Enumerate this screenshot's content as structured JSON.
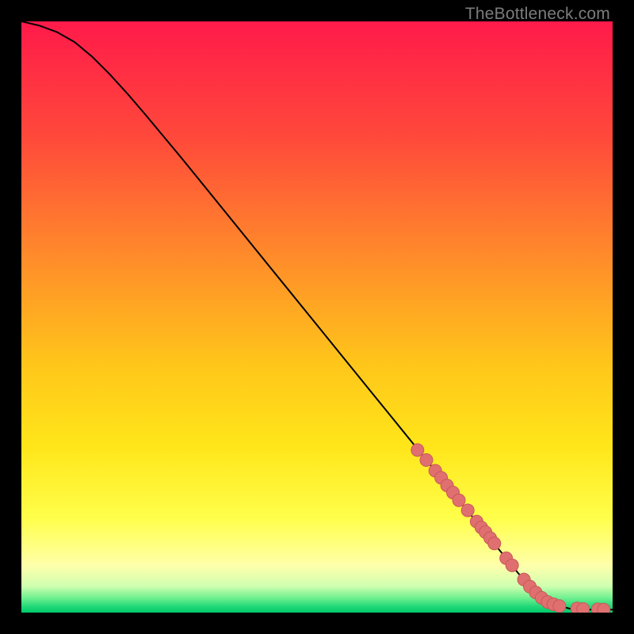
{
  "watermark": "TheBottleneck.com",
  "colors": {
    "gradient_stops": [
      {
        "offset": 0.0,
        "color": "#ff1a4a"
      },
      {
        "offset": 0.2,
        "color": "#ff4a3a"
      },
      {
        "offset": 0.4,
        "color": "#ff8c2a"
      },
      {
        "offset": 0.58,
        "color": "#ffc61a"
      },
      {
        "offset": 0.72,
        "color": "#ffe61a"
      },
      {
        "offset": 0.84,
        "color": "#ffff4a"
      },
      {
        "offset": 0.92,
        "color": "#ffffaa"
      },
      {
        "offset": 0.955,
        "color": "#d0ffb0"
      },
      {
        "offset": 0.975,
        "color": "#70f090"
      },
      {
        "offset": 0.99,
        "color": "#20d878"
      },
      {
        "offset": 1.0,
        "color": "#00c86a"
      }
    ],
    "line": "#000000",
    "marker_fill": "#e07070",
    "marker_stroke": "#c85858"
  },
  "chart_data": {
    "type": "line",
    "title": "",
    "xlabel": "",
    "ylabel": "",
    "xlim": [
      0,
      100
    ],
    "ylim": [
      0,
      100
    ],
    "series": [
      {
        "name": "curve",
        "x": [
          0,
          3,
          6,
          9,
          12,
          15,
          18,
          21,
          24,
          27,
          30,
          33,
          36,
          39,
          42,
          45,
          48,
          51,
          54,
          57,
          60,
          63,
          66,
          69,
          72,
          75,
          78,
          81,
          84,
          87,
          90,
          93,
          96,
          100
        ],
        "y": [
          100,
          99.3,
          98.2,
          96.5,
          94.0,
          91.0,
          87.7,
          84.2,
          80.6,
          77.0,
          73.3,
          69.6,
          65.9,
          62.2,
          58.5,
          54.8,
          51.1,
          47.4,
          43.7,
          40.0,
          36.3,
          32.6,
          28.9,
          25.2,
          21.5,
          17.8,
          14.1,
          10.4,
          6.7,
          3.4,
          1.4,
          0.6,
          0.5,
          0.5
        ]
      }
    ],
    "markers": {
      "name": "points",
      "x": [
        67,
        68.5,
        70,
        71,
        72,
        73,
        74,
        75.5,
        77,
        77.8,
        78.5,
        79.3,
        80,
        82,
        83,
        85,
        86,
        87,
        88,
        89,
        90,
        91,
        94,
        95,
        97.5,
        98.5
      ],
      "y": [
        27.5,
        25.8,
        24.0,
        22.8,
        21.5,
        20.3,
        19.0,
        17.3,
        15.4,
        14.4,
        13.6,
        12.6,
        11.7,
        9.2,
        8.0,
        5.6,
        4.4,
        3.4,
        2.5,
        1.8,
        1.4,
        1.1,
        0.7,
        0.6,
        0.55,
        0.5
      ]
    }
  }
}
